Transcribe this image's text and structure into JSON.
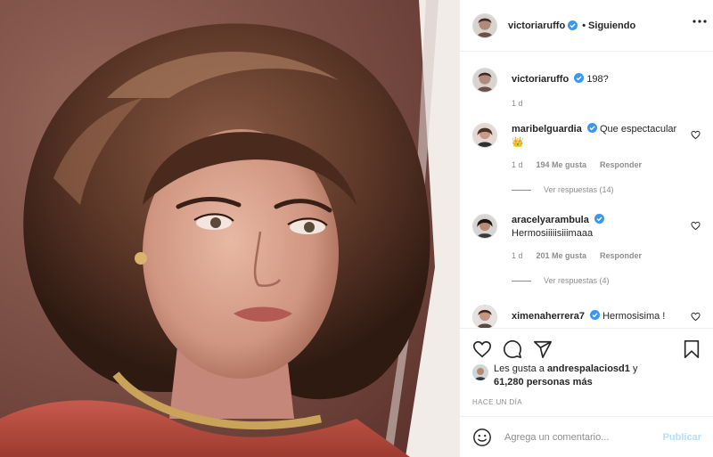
{
  "post": {
    "username": "victoriaruffo",
    "follow_separator": "•",
    "follow_status": "Siguiendo",
    "caption": {
      "username": "victoriaruffo",
      "text": "198?",
      "age": "1 d"
    }
  },
  "comments": [
    {
      "username": "maribelguardia",
      "text": "Que espectacular",
      "emoji": "👑",
      "age": "1 d",
      "likes": "194 Me gusta",
      "reply_label": "Responder",
      "view_replies": "Ver respuestas (14)"
    },
    {
      "username": "aracelyarambula",
      "text": "Hermosiiiiisiiimaaa",
      "age": "1 d",
      "likes": "201 Me gusta",
      "reply_label": "Responder",
      "view_replies": "Ver respuestas (4)"
    },
    {
      "username": "ximenaherrera7",
      "text": "Hermosisima !"
    }
  ],
  "likes_summary": {
    "prefix": "Les gusta a",
    "user": "andrespalaciosd1",
    "connector": "y",
    "count": "61,280 personas más"
  },
  "timestamp": "HACE UN DÍA",
  "add_comment": {
    "placeholder": "Agrega un comentario...",
    "publish_label": "Publicar"
  },
  "icons": {
    "verified": "verified-badge-icon",
    "like": "heart-icon",
    "comment": "comment-bubble-icon",
    "share": "paper-plane-icon",
    "save": "bookmark-icon",
    "emoji": "smiley-icon",
    "more": "more-options-icon"
  },
  "colors": {
    "verified_blue": "#3897f0",
    "publish_disabled": "#b2dffc",
    "muted_text": "#8e8e8e"
  }
}
